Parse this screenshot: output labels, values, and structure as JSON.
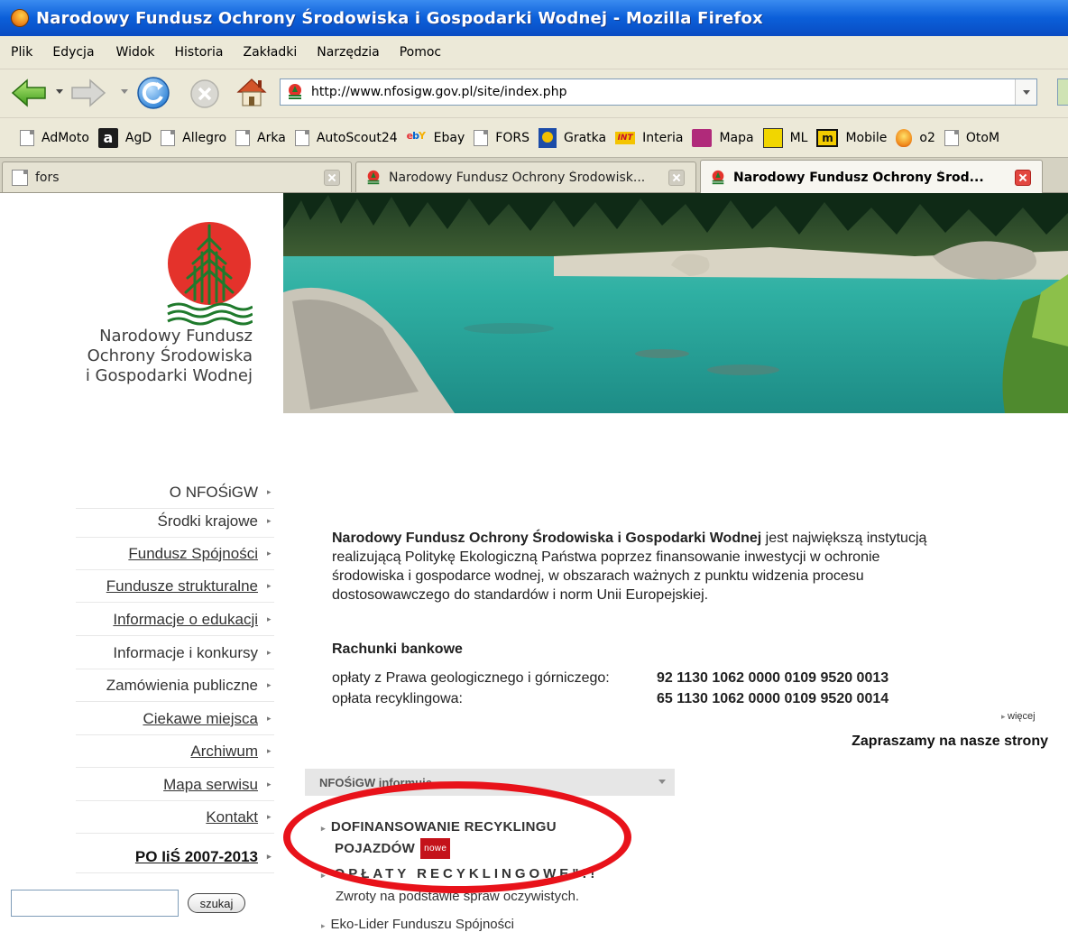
{
  "window": {
    "title": "Narodowy Fundusz Ochrony Środowiska i Gospodarki Wodnej - Mozilla Firefox"
  },
  "menu": [
    "Plik",
    "Edycja",
    "Widok",
    "Historia",
    "Zakładki",
    "Narzędzia",
    "Pomoc"
  ],
  "navigation": {
    "url": "http://www.nfosigw.gov.pl/site/index.php"
  },
  "bookmarks": [
    {
      "label": "AdMoto",
      "icon": "page-icon"
    },
    {
      "label": "AgD",
      "icon": "agd-icon"
    },
    {
      "label": "Allegro",
      "icon": "page-icon"
    },
    {
      "label": "Arka",
      "icon": "page-icon"
    },
    {
      "label": "AutoScout24",
      "icon": "ebay-icon"
    },
    {
      "label": "Ebay",
      "icon": "page-icon"
    },
    {
      "label": "FORS",
      "icon": "gratka-icon"
    },
    {
      "label": "Gratka",
      "icon": "interia-icon"
    },
    {
      "label": "Interia",
      "icon": "mapa-icon"
    },
    {
      "label": "Mapa",
      "icon": "ml-icon"
    },
    {
      "label": "ML",
      "icon": "mobile-icon"
    },
    {
      "label": "Mobile",
      "icon": "o2-icon"
    },
    {
      "label": "o2",
      "icon": "page-icon"
    },
    {
      "label": "OtoM",
      "icon": "page-icon"
    }
  ],
  "tabs": [
    {
      "label": "fors",
      "active": false
    },
    {
      "label": "Narodowy Fundusz Ochrony Środowisk...",
      "active": false
    },
    {
      "label": "Narodowy Fundusz Ochrony Środ...",
      "active": true
    }
  ],
  "logo": {
    "lines": [
      "Narodowy Fundusz",
      "Ochrony Środowiska",
      "i Gospodarki Wodnej"
    ]
  },
  "sidebar": {
    "items": [
      {
        "label": "O NFOŚiGW",
        "underline": false,
        "bold": false
      },
      {
        "label": "Środki krajowe",
        "underline": false,
        "bold": false
      },
      {
        "label": "Fundusz Spójności",
        "underline": true,
        "bold": false
      },
      {
        "label": "Fundusze strukturalne",
        "underline": true,
        "bold": false
      },
      {
        "label": "Informacje o edukacji",
        "underline": true,
        "bold": false
      },
      {
        "label": "Informacje i konkursy",
        "underline": false,
        "bold": false
      },
      {
        "label": "Zamówienia publiczne",
        "underline": false,
        "bold": false
      },
      {
        "label": "Ciekawe miejsca",
        "underline": true,
        "bold": false
      },
      {
        "label": "Archiwum",
        "underline": true,
        "bold": false
      },
      {
        "label": "Mapa serwisu",
        "underline": true,
        "bold": false
      },
      {
        "label": "Kontakt",
        "underline": true,
        "bold": false
      },
      {
        "label": "PO IiŚ 2007-2013",
        "underline": true,
        "bold": true
      }
    ],
    "search_button": "szukaj"
  },
  "main": {
    "intro_bold": "Narodowy Fundusz Ochrony Środowiska i Gospodarki Wodnej",
    "intro_line1_rest": " jest największą instytucją",
    "intro_line2": "realizującą Politykę Ekologiczną Państwa poprzez finansowanie inwestycji w ochronie",
    "intro_line3": "środowiska i gospodarce wodnej, w obszarach ważnych z punktu widzenia procesu",
    "intro_line4": "dostosowawczego do standardów i norm Unii Europejskiej.",
    "accounts_heading": "Rachunki bankowe",
    "accounts": [
      {
        "label": "opłaty z Prawa geologicznego i górniczego:",
        "number": "92 1130 1062 0000 0109 9520 0013"
      },
      {
        "label": "opłata recyklingowa:",
        "number": "65 1130 1062 0000 0109 9520 0014"
      }
    ],
    "more": "więcej",
    "invite": "Zapraszamy na nasze strony"
  },
  "news": {
    "header": "NFOŚiGW informuje",
    "item1_line1": "DOFINANSOWANIE RECYKLINGU",
    "item1_line2": "POJAZDÓW",
    "item1_badge": "nowe",
    "item2_title": "OPŁATY RECYKLINGOWE\"!!",
    "item2_sub": "Zwroty na podstawie spraw oczywistych.",
    "item3_title": "Eko-Lider Funduszu Spójności"
  },
  "colors": {
    "titlebar": "#0b5fd9",
    "chrome": "#ece9d8",
    "logo_red": "#e4322b",
    "logo_green": "#1f7a2c",
    "annotation_red": "#e8121a",
    "badge_red": "#c4121a"
  }
}
